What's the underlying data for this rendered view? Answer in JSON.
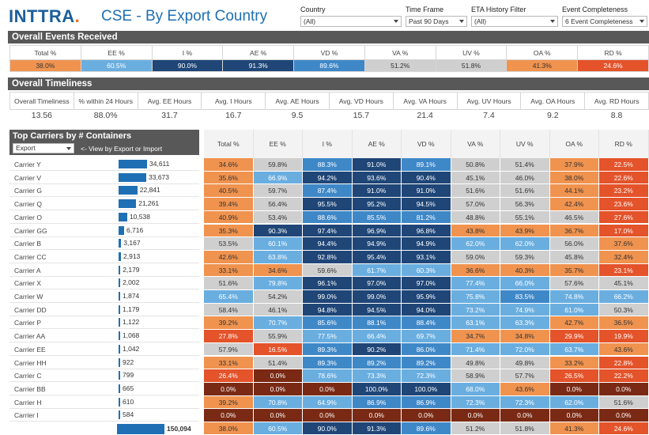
{
  "header": {
    "logo_text": "INTTRA",
    "logo_dot": ".",
    "title": "CSE - By Export Country"
  },
  "filters": [
    {
      "label": "Country",
      "value": "(All)"
    },
    {
      "label": "Time Frame",
      "value": "Past 90 Days"
    },
    {
      "label": "ETA History Filter",
      "value": "(All)"
    },
    {
      "label": "Event Completeness",
      "value": "6 Event Completeness"
    }
  ],
  "overall_events": {
    "title": "Overall Events Received",
    "columns": [
      "Total %",
      "EE %",
      "I %",
      "AE %",
      "VD %",
      "VA %",
      "UV %",
      "OA %",
      "RD %"
    ],
    "values": [
      "38.0%",
      "60.5%",
      "90.0%",
      "91.3%",
      "89.6%",
      "51.2%",
      "51.8%",
      "41.3%",
      "24.6%"
    ]
  },
  "overall_timeliness": {
    "title": "Overall Timeliness",
    "columns": [
      "Overall Timeliness",
      "% within 24 Hours",
      "Avg. EE Hours",
      "Avg. I Hours",
      "Avg. AE Hours",
      "Avg. VD Hours",
      "Avg. VA Hours",
      "Avg. UV Hours",
      "Avg. OA Hours",
      "Avg. RD Hours"
    ],
    "values": [
      "13.56",
      "88.0%",
      "31.7",
      "16.7",
      "9.5",
      "15.7",
      "21.4",
      "7.4",
      "9.2",
      "8.8"
    ]
  },
  "top_carriers": {
    "title": "Top Carriers by # Containers",
    "select_value": "Export",
    "view_link": "<- View by Export or Import",
    "columns": [
      "Total %",
      "EE %",
      "I %",
      "AE %",
      "VD %",
      "VA %",
      "UV %",
      "OA %",
      "RD %"
    ],
    "rows": [
      {
        "name": "Carrier Y",
        "count": "34,611",
        "bar": 1.0,
        "cells": [
          "34.6%",
          "59.8%",
          "88.3%",
          "91.0%",
          "89.1%",
          "50.8%",
          "51.4%",
          "37.9%",
          "22.5%"
        ]
      },
      {
        "name": "Carrier V",
        "count": "33,673",
        "bar": 0.973,
        "cells": [
          "35.6%",
          "66.9%",
          "94.2%",
          "93.6%",
          "90.4%",
          "45.1%",
          "46.0%",
          "38.0%",
          "22.6%"
        ]
      },
      {
        "name": "Carrier G",
        "count": "22,841",
        "bar": 0.66,
        "cells": [
          "40.5%",
          "59.7%",
          "87.4%",
          "91.0%",
          "91.0%",
          "51.6%",
          "51.6%",
          "44.1%",
          "23.2%"
        ]
      },
      {
        "name": "Carrier Q",
        "count": "21,261",
        "bar": 0.614,
        "cells": [
          "39.4%",
          "56.4%",
          "95.5%",
          "95.2%",
          "94.5%",
          "57.0%",
          "56.3%",
          "42.4%",
          "23.6%"
        ]
      },
      {
        "name": "Carrier O",
        "count": "10,538",
        "bar": 0.304,
        "cells": [
          "40.9%",
          "53.4%",
          "88.6%",
          "85.5%",
          "81.2%",
          "48.8%",
          "55.1%",
          "46.5%",
          "27.6%"
        ]
      },
      {
        "name": "Carrier GG",
        "count": "6,716",
        "bar": 0.194,
        "cells": [
          "35.3%",
          "90.3%",
          "97.4%",
          "96.9%",
          "96.8%",
          "43.8%",
          "43.9%",
          "36.7%",
          "17.0%"
        ]
      },
      {
        "name": "Carrier B",
        "count": "3,167",
        "bar": 0.0915,
        "cells": [
          "53.5%",
          "60.1%",
          "94.4%",
          "94.9%",
          "94.9%",
          "62.0%",
          "62.0%",
          "56.0%",
          "37.6%"
        ]
      },
      {
        "name": "Carrier CC",
        "count": "2,913",
        "bar": 0.0842,
        "cells": [
          "42.6%",
          "63.8%",
          "92.8%",
          "95.4%",
          "93.1%",
          "59.0%",
          "59.3%",
          "45.8%",
          "32.4%"
        ]
      },
      {
        "name": "Carrier A",
        "count": "2,179",
        "bar": 0.063,
        "cells": [
          "33.1%",
          "34.6%",
          "59.6%",
          "61.7%",
          "60.3%",
          "36.6%",
          "40.3%",
          "35.7%",
          "23.1%"
        ]
      },
      {
        "name": "Carrier X",
        "count": "2,002",
        "bar": 0.0578,
        "cells": [
          "51.6%",
          "79.8%",
          "96.1%",
          "97.0%",
          "97.0%",
          "77.4%",
          "66.0%",
          "57.6%",
          "45.1%"
        ]
      },
      {
        "name": "Carrier W",
        "count": "1,874",
        "bar": 0.0541,
        "cells": [
          "65.4%",
          "54.2%",
          "99.0%",
          "99.0%",
          "95.9%",
          "75.8%",
          "83.5%",
          "74.8%",
          "66.2%"
        ]
      },
      {
        "name": "Carrier DD",
        "count": "1,179",
        "bar": 0.034,
        "cells": [
          "58.4%",
          "46.1%",
          "94.8%",
          "94.5%",
          "94.0%",
          "73.2%",
          "74.9%",
          "61.0%",
          "50.3%"
        ]
      },
      {
        "name": "Carrier P",
        "count": "1,122",
        "bar": 0.0324,
        "cells": [
          "39.2%",
          "70.7%",
          "85.6%",
          "88.1%",
          "88.4%",
          "63.1%",
          "63.3%",
          "42.7%",
          "36.5%"
        ]
      },
      {
        "name": "Carrier AA",
        "count": "1,068",
        "bar": 0.0309,
        "cells": [
          "27.8%",
          "55.9%",
          "77.5%",
          "66.4%",
          "69.7%",
          "34.7%",
          "34.8%",
          "29.9%",
          "19.9%"
        ]
      },
      {
        "name": "Carrier EE",
        "count": "1,042",
        "bar": 0.0301,
        "cells": [
          "57.9%",
          "16.5%",
          "89.3%",
          "90.2%",
          "86.0%",
          "71.4%",
          "72.0%",
          "63.7%",
          "43.6%"
        ]
      },
      {
        "name": "Carrier HH",
        "count": "922",
        "bar": 0.0266,
        "cells": [
          "33.1%",
          "51.4%",
          "89.3%",
          "89.2%",
          "89.2%",
          "49.8%",
          "49.8%",
          "33.2%",
          "22.8%"
        ]
      },
      {
        "name": "Carrier C",
        "count": "799",
        "bar": 0.0231,
        "cells": [
          "26.4%",
          "0.0%",
          "78.6%",
          "73.3%",
          "72.3%",
          "58.9%",
          "57.7%",
          "26.5%",
          "22.2%"
        ]
      },
      {
        "name": "Carrier BB",
        "count": "665",
        "bar": 0.0192,
        "cells": [
          "0.0%",
          "0.0%",
          "0.0%",
          "100.0%",
          "100.0%",
          "68.0%",
          "43.6%",
          "0.0%",
          "0.0%"
        ]
      },
      {
        "name": "Carrier H",
        "count": "610",
        "bar": 0.0176,
        "cells": [
          "39.2%",
          "70.8%",
          "64.9%",
          "86.9%",
          "86.9%",
          "72.3%",
          "72.3%",
          "62.0%",
          "51.6%"
        ]
      },
      {
        "name": "Carrier I",
        "count": "584",
        "bar": 0.0169,
        "cells": [
          "0.0%",
          "0.0%",
          "0.0%",
          "0.0%",
          "0.0%",
          "0.0%",
          "0.0%",
          "0.0%",
          "0.0%"
        ]
      }
    ],
    "total": {
      "count": "150,094",
      "cells": [
        "38.0%",
        "60.5%",
        "90.0%",
        "91.3%",
        "89.6%",
        "51.2%",
        "51.8%",
        "41.3%",
        "24.6%"
      ]
    }
  },
  "colors": {
    "bar": "#1f6fb4",
    "section": "#585858",
    "dark_brown": "#7a2a14",
    "red_orange": "#e4532a",
    "orange": "#f0934f",
    "light_gray": "#cfcfcf",
    "light_blue": "#6aaee0",
    "mid_blue": "#3f88c8",
    "navy": "#1f4677"
  }
}
